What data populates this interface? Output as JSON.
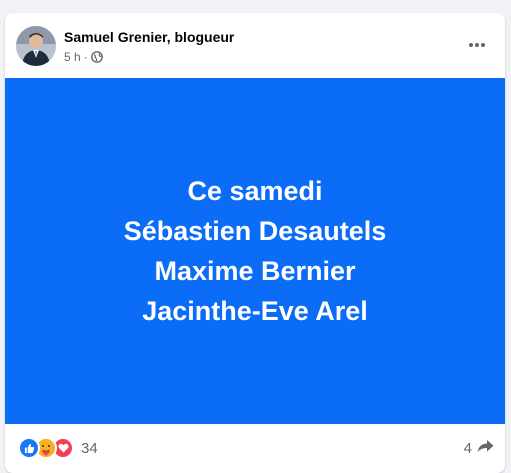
{
  "post": {
    "author": "Samuel Grenier, blogueur",
    "time": "5 h",
    "separator": "·",
    "audience_icon": "globe-icon",
    "more_icon": "more-options-icon"
  },
  "media": {
    "background": "#0a6cf7",
    "lines": [
      "Ce samedi",
      "Sébastien Desautels",
      "Maxime Bernier",
      "Jacinthe-Eve Arel"
    ]
  },
  "footer": {
    "reaction_icons": [
      "like-icon",
      "care-icon",
      "love-icon"
    ],
    "reaction_count": "34",
    "share_count": "4",
    "share_icon": "share-arrow-icon"
  },
  "colors": {
    "like": "#1877f2",
    "care": "#f7b125",
    "love": "#f33e58",
    "secondary_text": "#65676b"
  }
}
